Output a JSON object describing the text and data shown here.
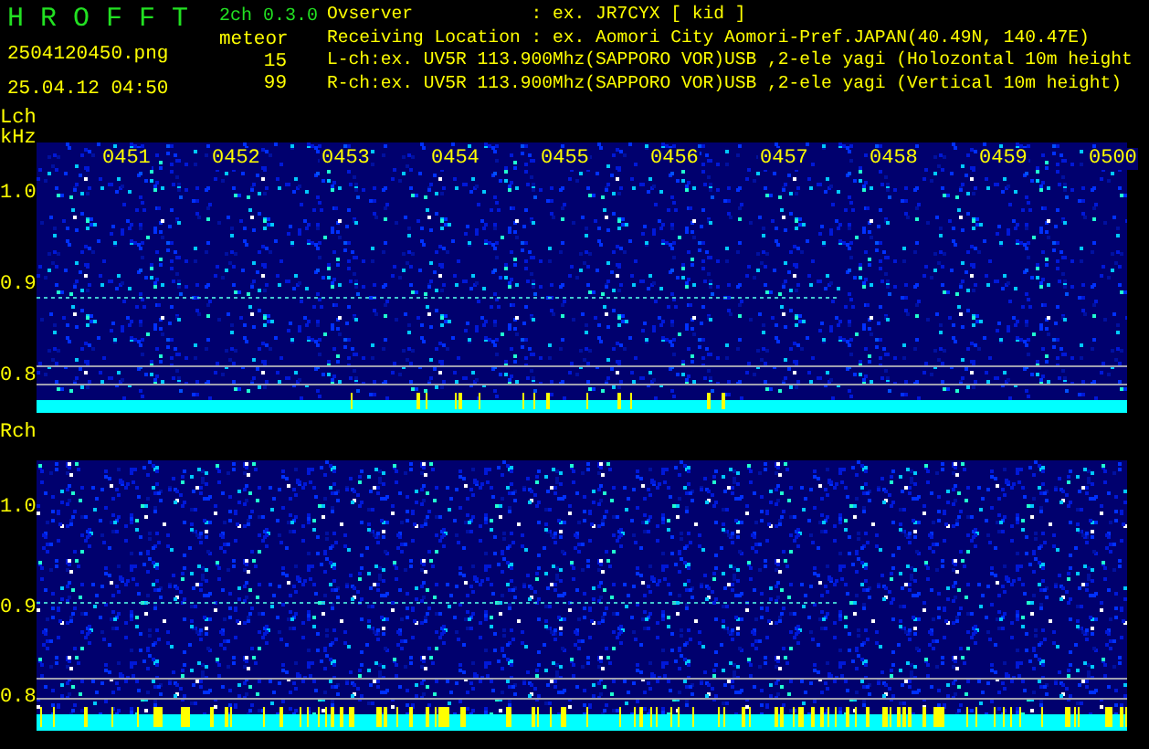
{
  "header": {
    "app_title": "H R O F F T",
    "version": "2ch 0.3.0",
    "filename": "2504120450.png",
    "datetime": "25.04.12 04:50",
    "meteor_label": "meteor",
    "meteor_counts": [
      "15",
      "99"
    ],
    "info_lines": [
      "Ovserver           : ex. JR7CYX [ kid ]",
      "Receiving Location : ex. Aomori City Aomori-Pref.JAPAN(40.49N, 140.47E)",
      "L-ch:ex. UV5R 113.900Mhz(SAPPORO VOR)USB ,2-ele yagi (Holozontal 10m height",
      "R-ch:ex. UV5R 113.900Mhz(SAPPORO VOR)USB ,2-ele yagi (Vertical 10m height)"
    ]
  },
  "channels": [
    {
      "label": "Lch",
      "unit": "kHz",
      "y_ticks": [
        "1.0",
        "0.9",
        "0.8"
      ],
      "time_labels": [
        "0451",
        "0452",
        "0453",
        "0454",
        "0455",
        "0456",
        "0457",
        "0458",
        "0459",
        "0500"
      ]
    },
    {
      "label": "Rch",
      "y_ticks": [
        "1.0",
        "0.9",
        "0.8"
      ]
    }
  ]
}
